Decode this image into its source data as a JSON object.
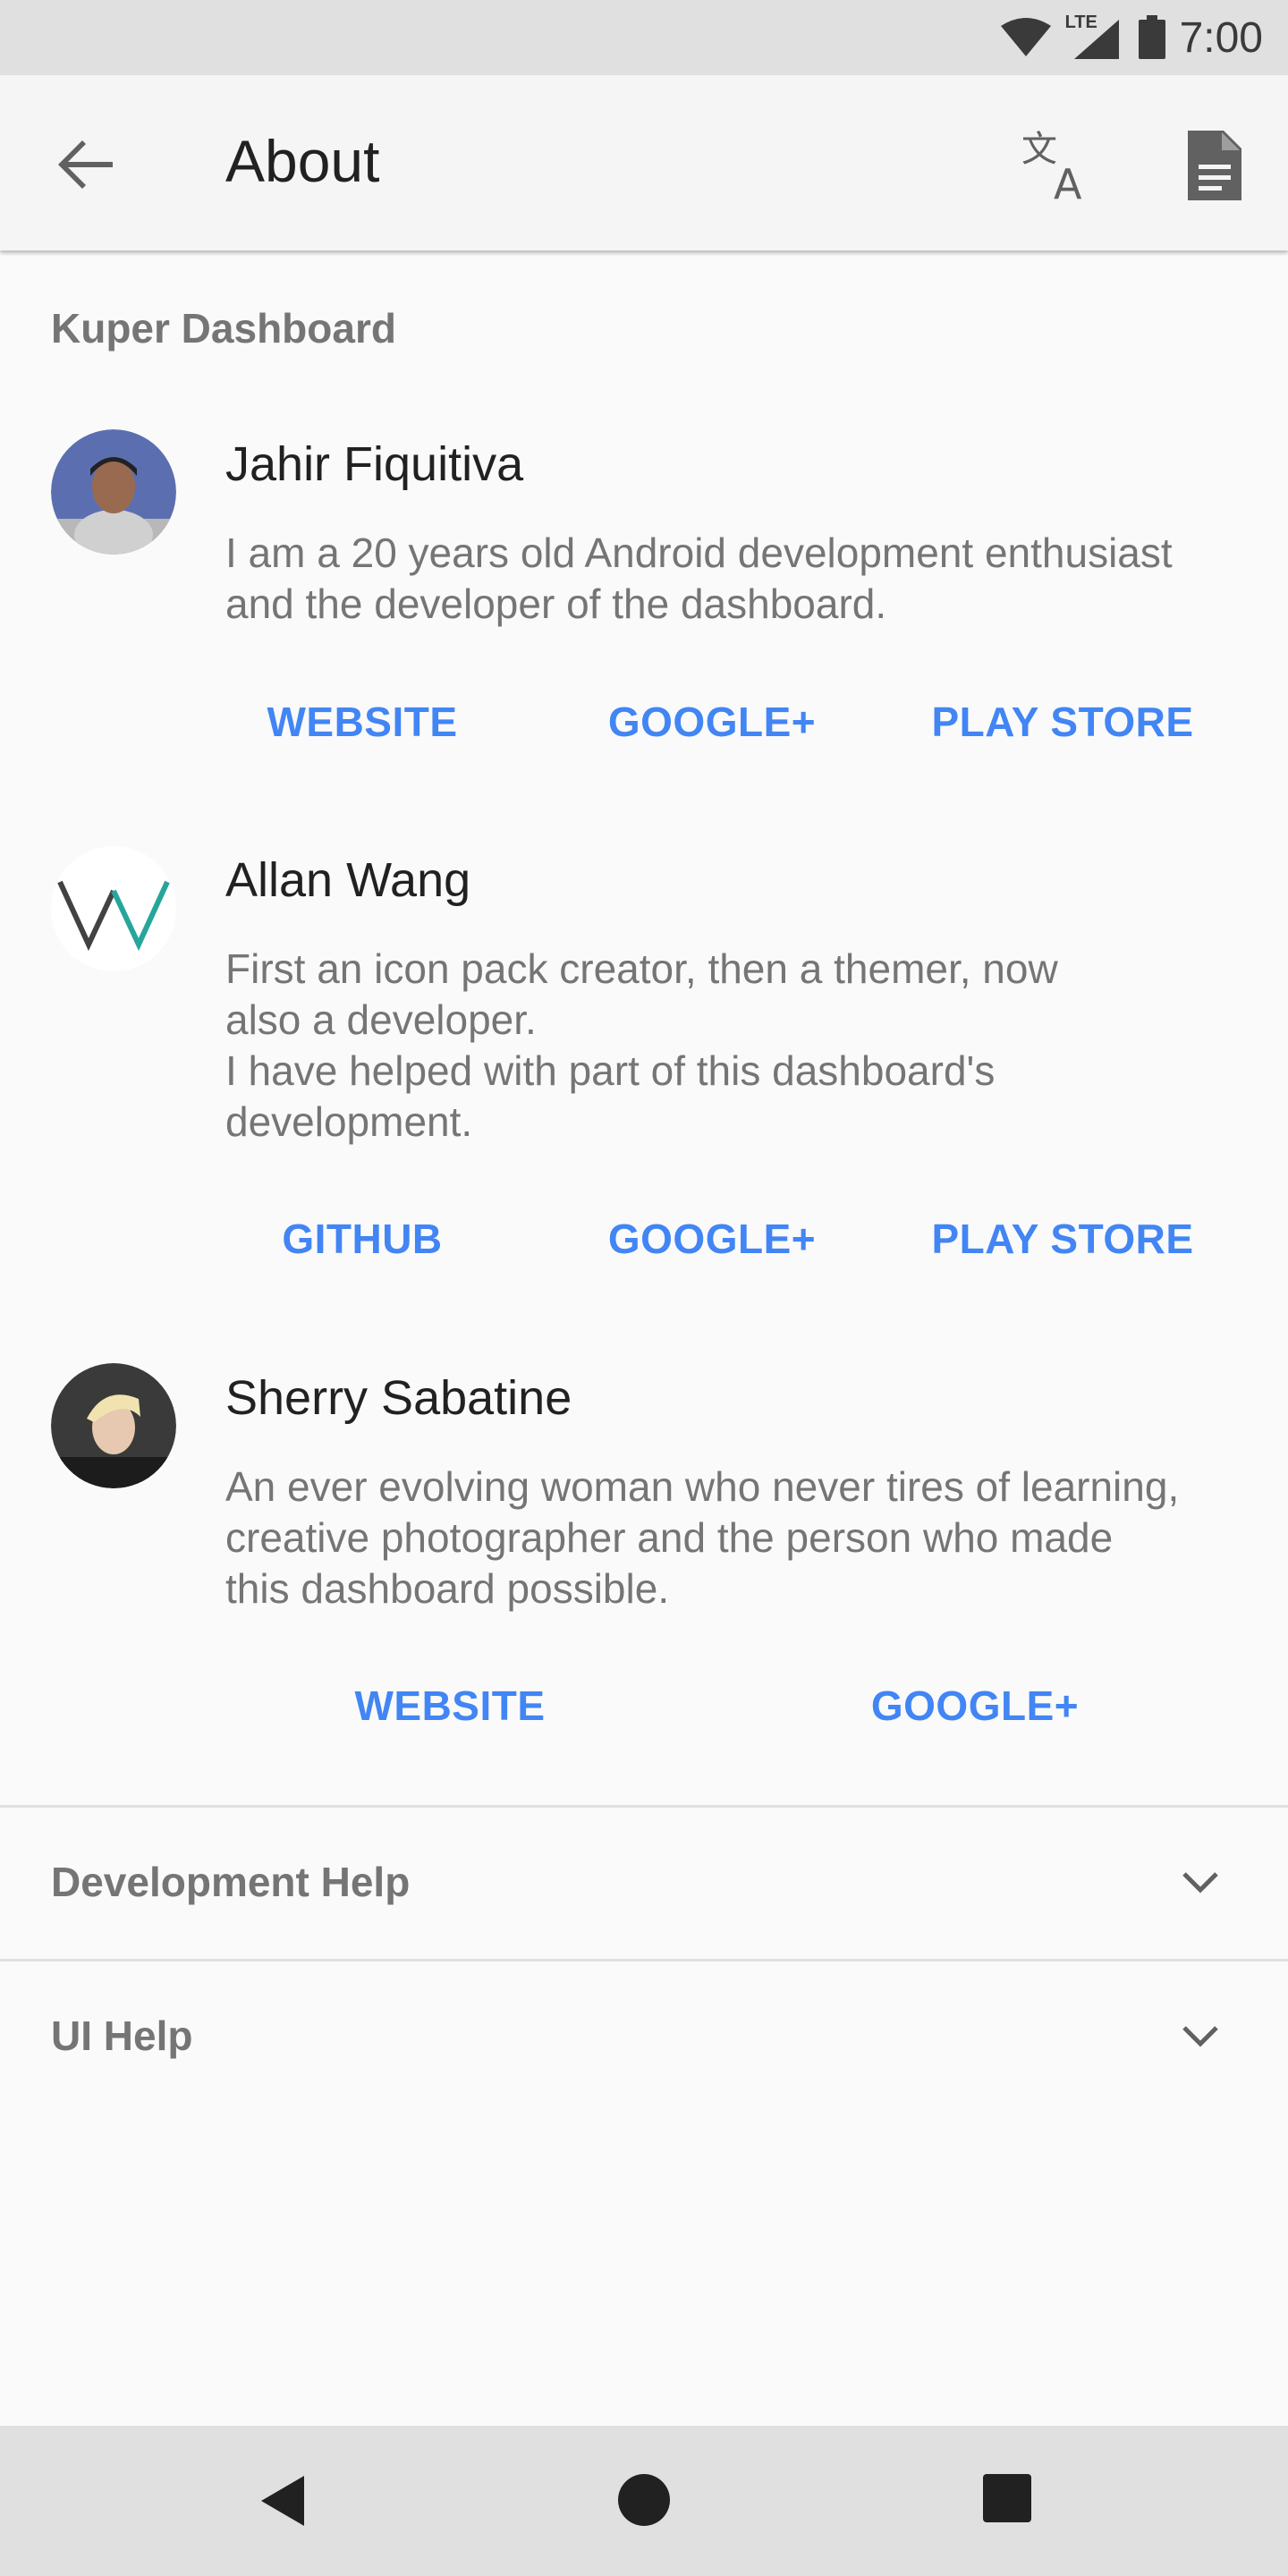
{
  "status_bar": {
    "time": "7:00",
    "network": "LTE",
    "icons": [
      "wifi-icon",
      "cellular-icon",
      "battery-icon"
    ]
  },
  "toolbar": {
    "title": "About",
    "icons": [
      "back-arrow-icon",
      "translate-icon",
      "document-icon"
    ]
  },
  "section": {
    "title": "Kuper Dashboard"
  },
  "people": [
    {
      "name": "Jahir Fiquitiva",
      "description": "I am a 20 years old Android development enthusiast\nand the developer of the dashboard.",
      "links": [
        "WEBSITE",
        "GOOGLE+",
        "PLAY STORE"
      ]
    },
    {
      "name": "Allan Wang",
      "description": "First an icon pack creator, then a themer, now\nalso a developer.\nI have helped with part of this dashboard's\ndevelopment.",
      "links": [
        "GITHUB",
        "GOOGLE+",
        "PLAY STORE"
      ]
    },
    {
      "name": "Sherry Sabatine",
      "description": "An ever evolving woman who never tires of learning,\ncreative photographer and the person who made\nthis dashboard possible.",
      "links": [
        "WEBSITE",
        "GOOGLE+"
      ]
    }
  ],
  "expanders": [
    {
      "label": "Development Help"
    },
    {
      "label": "UI Help"
    }
  ],
  "colors": {
    "accent": "#4285f4",
    "muted_text": "#757575",
    "primary_text": "#212121",
    "background": "#fafafa"
  }
}
